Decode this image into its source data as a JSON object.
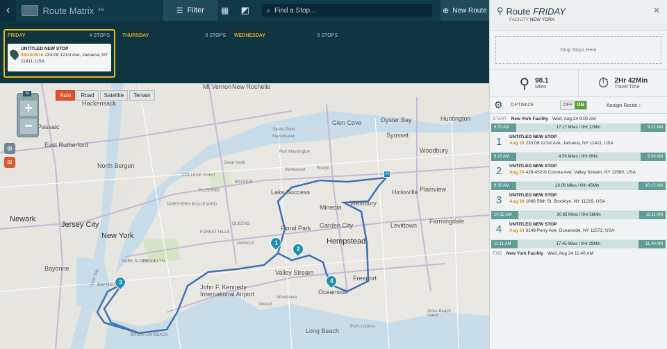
{
  "topbar": {
    "back_icon": "chevron-left",
    "app_name": "Route Matrix",
    "app_name_suffix": "3M",
    "filter_label": "Filter",
    "search_placeholder": "Find a Stop...",
    "new_route_label": "New Route"
  },
  "days": [
    {
      "name": "FRIDAY",
      "count": "4 STOPS",
      "active": true,
      "stop": {
        "name": "UNTITLED NEW STOP",
        "date": "08/24/2016",
        "address": "233-08 121st Ave, Jamaica, NY 11411, USA"
      }
    },
    {
      "name": "THURSDAY",
      "count": "0 STOPS"
    },
    {
      "name": "WEDNESDAY",
      "count": "0 STOPS"
    }
  ],
  "map": {
    "map_types": [
      "Auto",
      "Road",
      "Satellite",
      "Terrain"
    ],
    "active_type": "Auto",
    "compass": "N",
    "labels": {
      "hackensack": "Hackensack",
      "passaic": "Passaic",
      "rutherford": "East Rutherford",
      "northbergen": "North Bergen",
      "newark": "Newark",
      "jerseycity": "Jersey City",
      "newyork": "New York",
      "bayonne": "Bayonne",
      "mtvernon": "Mt Vernon",
      "newrochelle": "New Rochelle",
      "huntington": "Huntington",
      "glencove": "Glen Cove",
      "oysterbay": "Oyster Bay",
      "sandspoint": "Sands Point",
      "manorhaven": "Manorhaven",
      "portwash": "Port Washington",
      "manhasset": "Manhasset",
      "roslyn": "Roslyn",
      "syosset": "Syosset",
      "woodbury": "Woodbury",
      "hicksville": "Hicksville",
      "plainview": "Plainview",
      "farmingdale": "Farmingdale",
      "levittown": "Levittown",
      "westbury": "Westbury",
      "mineola": "Mineola",
      "gardencity": "Garden City",
      "lakesuccess": "Lake Success",
      "floralpark": "Floral Park",
      "queens": "QUEENS",
      "hempstead": "Hempstead",
      "valleystream": "Valley Stream",
      "freeport": "Freeport",
      "jfk": "John F. Kennedy International Airport",
      "woodmere": "Woodmere",
      "inwood": "Inwood",
      "oceanside": "Oceanside",
      "brooklyn": "BROOKLYN",
      "pointlookout": "Point Lookout",
      "longbeach": "Long Beach",
      "jonesbeach": "Jones Beach Island",
      "jamaica": "JAMAICA",
      "forresthills": "FOREST HILLS",
      "parkslope": "PARK SLOPE",
      "bayridge": "BAY RIDGE",
      "brightonbeach": "BRIGHTON BEACH",
      "upperbay": "Upper Bay",
      "greatneck": "Great Neck",
      "flushing": "FLUSHING",
      "bayside": "BAYSIDE",
      "colpoint": "COLLEGE POINT",
      "northtown": "NORTHERN BOULEVARD"
    },
    "markers": [
      "1",
      "2",
      "3",
      "4"
    ]
  },
  "panel": {
    "route_label": "Route",
    "route_day": "FRIDAY",
    "facility_label": "FACILITY",
    "facility_name": "NEW YORK",
    "drop_text": "Drop Stops Here",
    "miles_value": "98.1",
    "miles_label": "Miles",
    "time_value": "2Hr 42Min",
    "time_label": "Travel Time",
    "optimize_label": "OPTIMIZE",
    "toggle_off": "OFF",
    "toggle_on": "ON",
    "assign_label": "Assign Route",
    "start": {
      "tag": "START",
      "name": "New York Facility",
      "time": "Wed, Aug 24 9:00 AM"
    },
    "end": {
      "tag": "END",
      "name": "New York Facility",
      "time": "Wed, Aug 24 11:40 AM"
    },
    "legs": [
      {
        "from": "9:00 AM",
        "mid": "17.17 Miles / 0Hr 22Min",
        "to": "9:22 AM"
      },
      {
        "from": "9:22 AM",
        "mid": "4.56 Miles / 0Hr 8Min",
        "to": "9:30 AM"
      },
      {
        "from": "9:30 AM",
        "mid": "28.06 Miles / 0Hr 45Min",
        "to": "10:15 AM"
      },
      {
        "from": "10:15 AM",
        "mid": "30.85 Miles / 0Hr 56Min",
        "to": "11:11 AM"
      },
      {
        "from": "11:11 AM",
        "mid": "17.45 Miles / 0Hr 29Min",
        "to": "11:40 AM"
      }
    ],
    "stops": [
      {
        "num": "1",
        "name": "UNTITLED NEW STOP",
        "date": "Aug 24",
        "address": "233 08 121st Ave, Jamaica, NY 11411, USA"
      },
      {
        "num": "2",
        "name": "UNTITLED NEW STOP",
        "date": "Aug 24",
        "address": "426-452 N Corona Ave, Valley Stream, NY 11580, USA"
      },
      {
        "num": "3",
        "name": "UNTITLED NEW STOP",
        "date": "Aug 24",
        "address": "1066 58th St, Brooklyn, NY 11219, USA"
      },
      {
        "num": "4",
        "name": "UNTITLED NEW STOP",
        "date": "Aug 24",
        "address": "3148 Perry Ave, Oceanside, NY 11572, USA"
      }
    ]
  }
}
